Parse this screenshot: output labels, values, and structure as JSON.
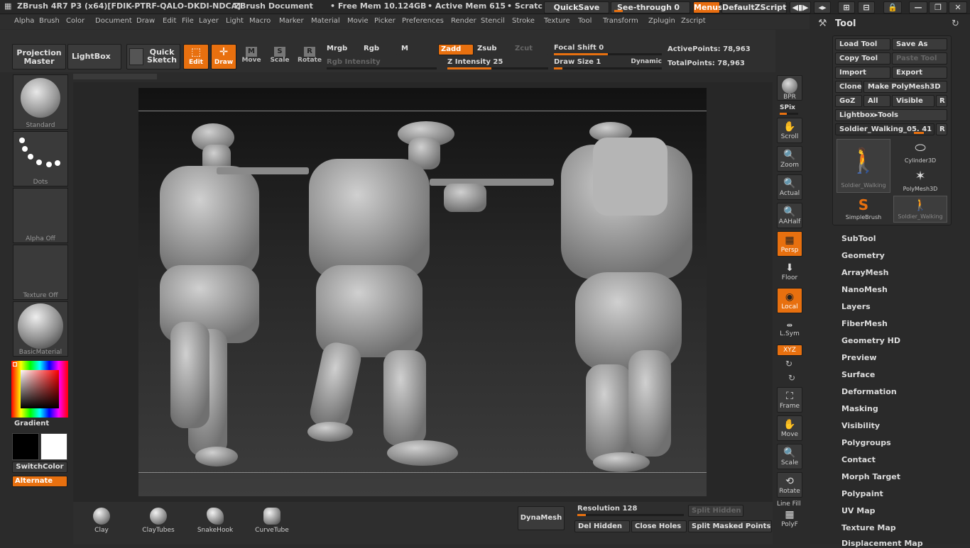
{
  "titlebar": {
    "app": "ZBrush 4R7 P3 (x64)[FDIK-PTRF-QALO-DKDI-NDCA]",
    "document": "ZBrush Document",
    "free_mem": "• Free Mem 10.124GB",
    "active_mem": "• Active Mem 615",
    "scratch": "• Scratc",
    "quicksave": "QuickSave",
    "see_through_label": "See-through",
    "see_through_value": "0",
    "menus": "Menus",
    "default_zscript": "DefaultZScript"
  },
  "menubar": [
    "Alpha",
    "Brush",
    "Color",
    "Document",
    "Draw",
    "Edit",
    "File",
    "Layer",
    "Light",
    "Macro",
    "Marker",
    "Material",
    "Movie",
    "Picker",
    "Preferences",
    "Render",
    "Stencil",
    "Stroke",
    "Texture",
    "Tool",
    "Transform",
    "Zplugin",
    "Zscript"
  ],
  "toolbar": {
    "projection_master": "Projection Master",
    "lightbox": "LightBox",
    "quick_sketch": "Quick Sketch",
    "edit": "Edit",
    "draw": "Draw",
    "move": "Move",
    "scale": "Scale",
    "rotate": "Rotate",
    "mrgb": "Mrgb",
    "rgb": "Rgb",
    "m": "M",
    "zadd": "Zadd",
    "zsub": "Zsub",
    "zcut": "Zcut",
    "rgb_intensity": "Rgb Intensity",
    "z_intensity_label": "Z Intensity",
    "z_intensity_value": "25",
    "focal_shift_label": "Focal Shift",
    "focal_shift_value": "0",
    "draw_size_label": "Draw Size",
    "draw_size_value": "1",
    "dynamic": "Dynamic",
    "active_points": "ActivePoints: 78,963",
    "total_points": "TotalPoints: 78,963"
  },
  "leftshelf": {
    "brush": "Standard",
    "stroke": "Dots",
    "alpha": "Alpha Off",
    "texture": "Texture Off",
    "material": "BasicMaterial",
    "gradient": "Gradient",
    "switch_color": "SwitchColor",
    "alternate": "Alternate"
  },
  "rightshelf": [
    {
      "name": "bpr",
      "label": "BPR",
      "icon": "render-icon"
    },
    {
      "name": "spix",
      "label": "SPix",
      "icon": "slider-icon"
    },
    {
      "name": "scroll",
      "label": "Scroll",
      "icon": "hand-icon"
    },
    {
      "name": "zoom",
      "label": "Zoom",
      "icon": "magnifier-icon"
    },
    {
      "name": "actual",
      "label": "Actual",
      "icon": "magnifier-icon"
    },
    {
      "name": "aahalf",
      "label": "AAHalf",
      "icon": "magnifier-icon"
    },
    {
      "name": "persp",
      "label": "Persp",
      "icon": "grid-icon"
    },
    {
      "name": "floor",
      "label": "Floor",
      "icon": "floor-icon"
    },
    {
      "name": "local",
      "label": "Local",
      "icon": "target-icon"
    },
    {
      "name": "lsym",
      "label": "L.Sym",
      "icon": "symmetry-icon"
    },
    {
      "name": "xyz",
      "label": "XYZ",
      "icon": "axis-icon"
    },
    {
      "name": "frame",
      "label": "Frame",
      "icon": "frame-icon"
    },
    {
      "name": "move",
      "label": "Move",
      "icon": "hand-icon"
    },
    {
      "name": "scale",
      "label": "Scale",
      "icon": "magnifier-icon"
    },
    {
      "name": "rotate",
      "label": "Rotate",
      "icon": "rotate-icon"
    },
    {
      "name": "linefill",
      "label": "Line Fill",
      "icon": "grid-icon"
    },
    {
      "name": "polyf",
      "label": "PolyF",
      "icon": "grid-icon"
    }
  ],
  "toolpanel": {
    "title": "Tool",
    "load_tool": "Load Tool",
    "save_as": "Save As",
    "copy_tool": "Copy Tool",
    "paste_tool": "Paste Tool",
    "import": "Import",
    "export": "Export",
    "clone": "Clone",
    "make_polymesh": "Make PolyMesh3D",
    "goz": "GoZ",
    "all": "All",
    "visible": "Visible",
    "r": "R",
    "lightbox_tools": "Lightbox▸Tools",
    "current_tool": "Soldier_Walking_05. 41",
    "tools": [
      {
        "label": "Soldier_Walking",
        "icon": "soldier-icon"
      },
      {
        "label": "Cylinder3D",
        "icon": "cylinder-icon"
      },
      {
        "label": "PolyMesh3D",
        "icon": "star-icon"
      },
      {
        "label": "SimpleBrush",
        "icon": "simplebrush-icon"
      },
      {
        "label": "Soldier_Walking",
        "icon": "soldier-icon"
      }
    ],
    "subpalettes": [
      "SubTool",
      "Geometry",
      "ArrayMesh",
      "NanoMesh",
      "Layers",
      "FiberMesh",
      "Geometry HD",
      "Preview",
      "Surface",
      "Deformation",
      "Masking",
      "Visibility",
      "Polygroups",
      "Contact",
      "Morph Target",
      "Polypaint",
      "UV Map",
      "Texture Map",
      "Displacement Map"
    ]
  },
  "bottomshelf": {
    "brushes": [
      "Clay",
      "ClayTubes",
      "SnakeHook",
      "CurveTube"
    ],
    "dynamesh": "DynaMesh",
    "resolution_label": "Resolution",
    "resolution_value": "128",
    "split_hidden": "Split Hidden",
    "del_hidden": "Del Hidden",
    "close_holes": "Close Holes",
    "split_masked": "Split Masked Points"
  },
  "colors": {
    "accent": "#e8700f",
    "bg": "#2b2b2b"
  }
}
